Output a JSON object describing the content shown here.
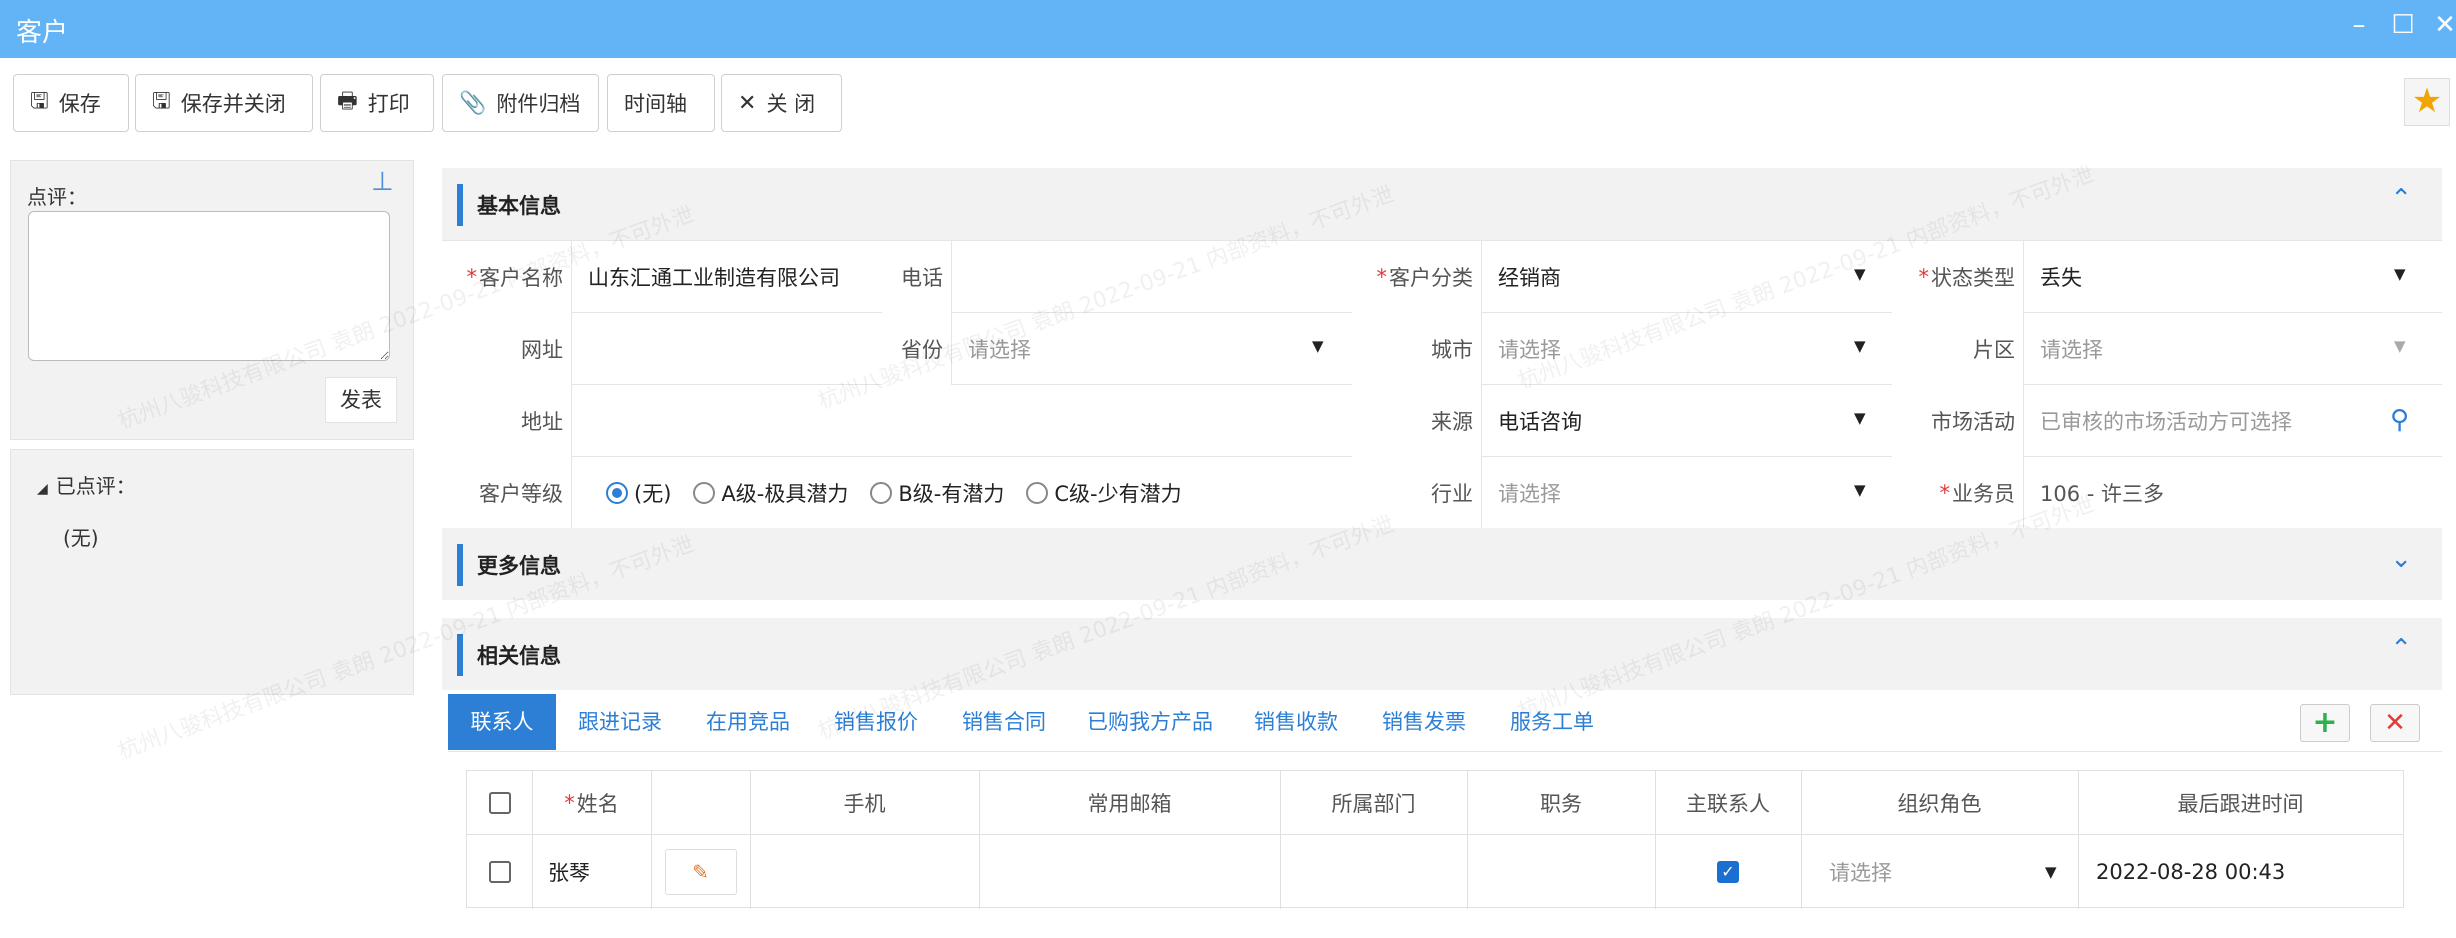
{
  "window": {
    "title": "客户",
    "minimize_icon": "minimize-icon",
    "maximize_icon": "maximize-icon",
    "close_icon": "close-icon"
  },
  "toolbar": {
    "save": "保存",
    "save_close": "保存并关闭",
    "print": "打印",
    "attachment_archive": "附件归档",
    "timeline": "时间轴",
    "close": "关 闭"
  },
  "review": {
    "label": "点评：",
    "post": "发表",
    "reviewed_header": "已点评：",
    "reviewed_empty": "(无)"
  },
  "basic_info": {
    "title": "基本信息",
    "fields": {
      "customer_name_label": "客户名称",
      "customer_name": "山东汇通工业制造有限公司",
      "phone_label": "电话",
      "phone": "",
      "category_label": "客户分类",
      "category": "经销商",
      "status_label": "状态类型",
      "status": "丢失",
      "website_label": "网址",
      "province_label": "省份",
      "province_placeholder": "请选择",
      "city_label": "城市",
      "city_placeholder": "请选择",
      "region_label": "片区",
      "region_placeholder": "请选择",
      "address_label": "地址",
      "source_label": "来源",
      "source": "电话咨询",
      "campaign_label": "市场活动",
      "campaign_placeholder": "已审核的市场活动方可选择",
      "level_label": "客户等级",
      "level_options": [
        "(无)",
        "A级-极具潜力",
        "B级-有潜力",
        "C级-少有潜力"
      ],
      "industry_label": "行业",
      "industry_placeholder": "请选择",
      "salesperson_label": "业务员",
      "salesperson": "106 - 许三多"
    }
  },
  "more_info": {
    "title": "更多信息"
  },
  "related_info": {
    "title": "相关信息",
    "tabs": [
      "联系人",
      "跟进记录",
      "在用竞品",
      "销售报价",
      "销售合同",
      "已购我方产品",
      "销售收款",
      "销售发票",
      "服务工单"
    ],
    "add": "+",
    "remove": "✕"
  },
  "contacts_table": {
    "headers": [
      "姓名",
      "手机",
      "常用邮箱",
      "所属部门",
      "职务",
      "主联系人",
      "组织角色",
      "最后跟进时间"
    ],
    "rows": [
      {
        "name": "张琴",
        "mobile": "",
        "email": "",
        "department": "",
        "position": "",
        "is_primary": true,
        "role_placeholder": "请选择",
        "last_follow": "2022-08-28 00:43"
      }
    ]
  },
  "watermark": "杭州八骏科技有限公司 袁朗 2022-09-21 内部资料，不可外泄"
}
